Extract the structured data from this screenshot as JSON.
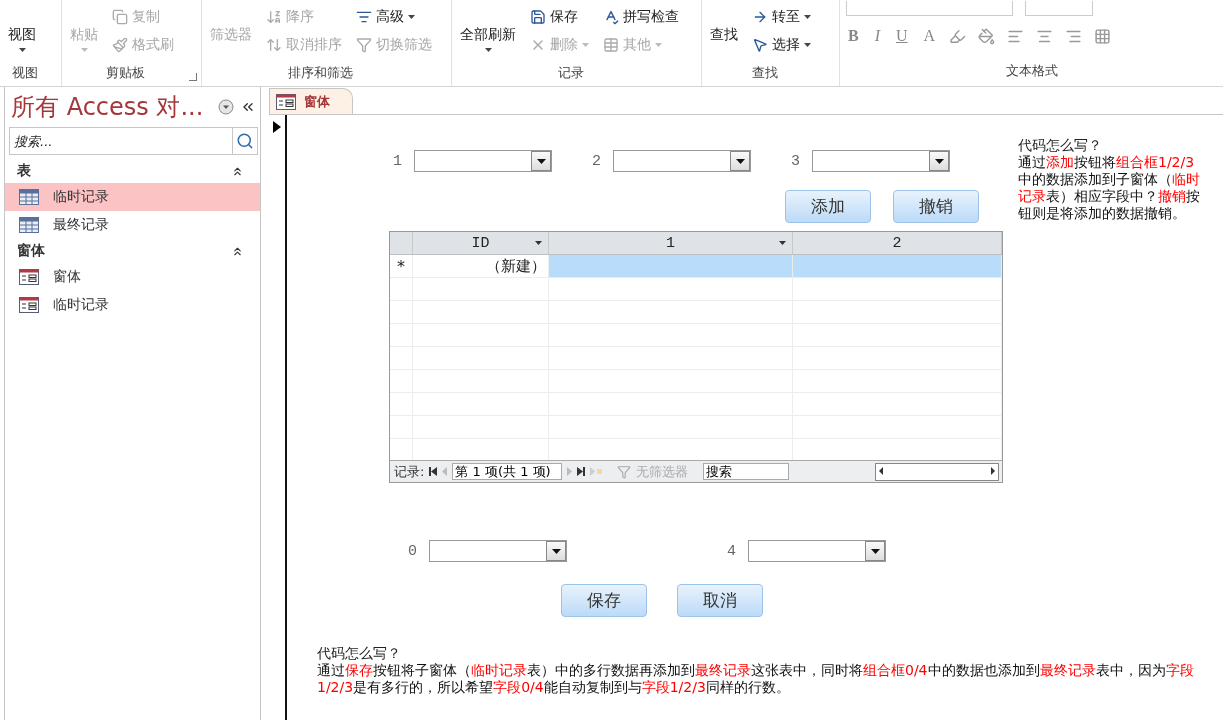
{
  "ribbon": {
    "groups": [
      {
        "label": "视图",
        "launcher": false,
        "columns": [
          [
            {
              "kind": "large",
              "label": "视图",
              "disabled": false,
              "dropdown": true
            }
          ]
        ]
      },
      {
        "label": "剪贴板",
        "launcher": true,
        "columns": [
          [
            {
              "kind": "large",
              "label": "粘贴",
              "disabled": true,
              "dropdown": true
            }
          ],
          [
            {
              "kind": "small",
              "label": "复制",
              "disabled": true,
              "dropdown": false
            },
            {
              "kind": "small",
              "label": "格式刷",
              "disabled": true,
              "dropdown": false
            }
          ]
        ]
      },
      {
        "label": "排序和筛选",
        "launcher": false,
        "columns": [
          [
            {
              "kind": "large",
              "label": "筛选器",
              "disabled": true,
              "dropdown": false
            }
          ],
          [
            {
              "kind": "small",
              "label": "降序",
              "disabled": true,
              "dropdown": false
            },
            {
              "kind": "small",
              "label": "取消排序",
              "disabled": true,
              "dropdown": false
            }
          ],
          [
            {
              "kind": "small",
              "label": "高级",
              "disabled": false,
              "dropdown": true
            },
            {
              "kind": "small",
              "label": "切换筛选",
              "disabled": true,
              "dropdown": false
            }
          ]
        ]
      },
      {
        "label": "记录",
        "launcher": false,
        "columns": [
          [
            {
              "kind": "large",
              "label": "全部刷新",
              "disabled": false,
              "dropdown": true
            }
          ],
          [
            {
              "kind": "small",
              "label": "保存",
              "disabled": false,
              "dropdown": false
            },
            {
              "kind": "small",
              "label": "删除",
              "disabled": true,
              "dropdown": true
            }
          ],
          [
            {
              "kind": "small",
              "label": "拼写检查",
              "disabled": false,
              "dropdown": false
            },
            {
              "kind": "small",
              "label": "其他",
              "disabled": true,
              "dropdown": true
            }
          ]
        ]
      },
      {
        "label": "查找",
        "launcher": false,
        "columns": [
          [
            {
              "kind": "large",
              "label": "查找",
              "disabled": false,
              "dropdown": false
            }
          ],
          [
            {
              "kind": "small",
              "label": "转至",
              "disabled": false,
              "dropdown": true
            },
            {
              "kind": "small",
              "label": "选择",
              "disabled": false,
              "dropdown": true
            }
          ]
        ]
      }
    ],
    "text_format": {
      "label": "文本格式",
      "style_buttons": [
        "B",
        "I",
        "U"
      ],
      "font_color_button": "A"
    }
  },
  "nav_pane": {
    "title": "所有 Access 对...",
    "search": {
      "placeholder": "搜索..."
    },
    "sections": [
      {
        "label": "表",
        "expanded": true,
        "items": [
          {
            "label": "临时记录",
            "kind": "table",
            "selected": true
          },
          {
            "label": "最终记录",
            "kind": "table",
            "selected": false
          }
        ]
      },
      {
        "label": "窗体",
        "expanded": true,
        "items": [
          {
            "label": "窗体",
            "kind": "form",
            "selected": false
          },
          {
            "label": "临时记录",
            "kind": "form",
            "selected": false
          }
        ]
      }
    ]
  },
  "document_tab": {
    "label": "窗体"
  },
  "form": {
    "top_combos": [
      {
        "label": "1"
      },
      {
        "label": "2"
      },
      {
        "label": "3"
      }
    ],
    "top_buttons": [
      "添加",
      "撤销"
    ],
    "subform": {
      "columns": [
        {
          "label": "ID",
          "dropdown": true
        },
        {
          "label": "1",
          "dropdown": true
        },
        {
          "label": "2",
          "dropdown": false
        }
      ],
      "new_row": {
        "marker": "*",
        "cells": [
          "（新建）",
          "",
          ""
        ],
        "selected": true
      },
      "nav": {
        "label": "记录:",
        "position": "第 1 项(共 1 项)",
        "filter": "无筛选器",
        "search": "搜索"
      }
    },
    "bottom_combos": [
      {
        "label": "0"
      },
      {
        "label": "4"
      }
    ],
    "bottom_buttons": [
      "保存",
      "取消"
    ]
  },
  "right_note": {
    "title": "代码怎么写？",
    "segments": [
      {
        "text": "通过",
        "highlight": false
      },
      {
        "text": "添加",
        "highlight": true
      },
      {
        "text": "按钮将",
        "highlight": false
      },
      {
        "text": "组合框1/2/3",
        "highlight": true
      },
      {
        "text": "中的数据添加到子窗体（",
        "highlight": false
      },
      {
        "text": "临时记录",
        "highlight": true
      },
      {
        "text": "表）相应字段中？",
        "highlight": false
      },
      {
        "text": "撤销",
        "highlight": true
      },
      {
        "text": "按钮则是将添加的数据撤销。",
        "highlight": false
      }
    ]
  },
  "bottom_note": {
    "title": "代码怎么写？",
    "segments": [
      {
        "text": "通过",
        "highlight": false
      },
      {
        "text": "保存",
        "highlight": true
      },
      {
        "text": "按钮将子窗体（",
        "highlight": false
      },
      {
        "text": "临时记录",
        "highlight": true
      },
      {
        "text": "表）中的多行数据再添加到",
        "highlight": false
      },
      {
        "text": "最终记录",
        "highlight": true
      },
      {
        "text": "这张表中，同时将",
        "highlight": false
      },
      {
        "text": "组合框0/4",
        "highlight": true
      },
      {
        "text": "中的数据也添加到",
        "highlight": false
      },
      {
        "text": "最终记录",
        "highlight": true
      },
      {
        "text": "表中，因为",
        "highlight": false
      },
      {
        "text": "字段1/2/3",
        "highlight": true
      },
      {
        "text": "是有多行的，所以希望",
        "highlight": false
      },
      {
        "text": "字段0/4",
        "highlight": true
      },
      {
        "text": "能自动复制到与",
        "highlight": false
      },
      {
        "text": "字段1/2/3",
        "highlight": true
      },
      {
        "text": "同样的行数。",
        "highlight": false
      }
    ]
  }
}
